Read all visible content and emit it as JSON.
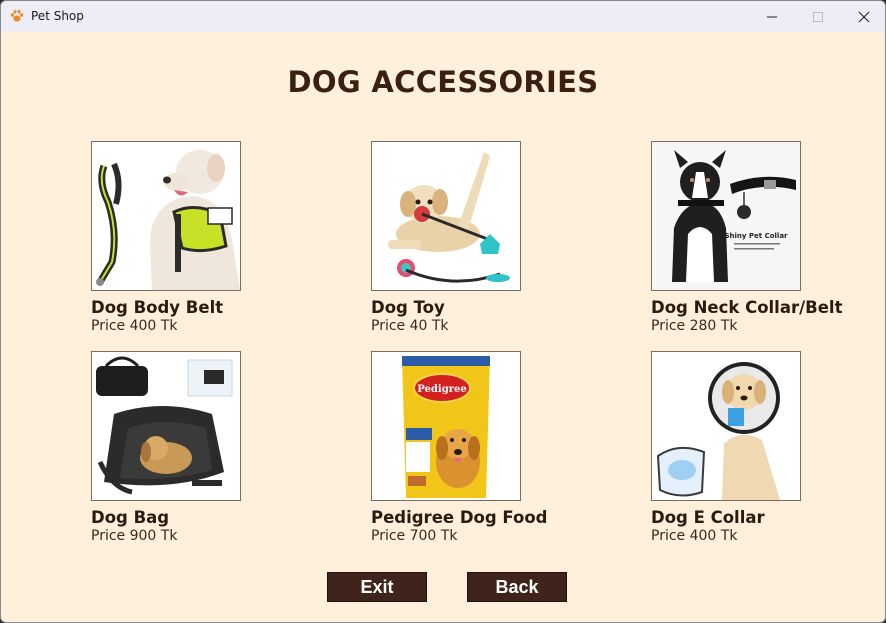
{
  "window": {
    "title": "Pet Shop",
    "icon": "paw-icon"
  },
  "page": {
    "heading": "DOG ACCESSORIES"
  },
  "products": [
    {
      "name": "Dog Body Belt",
      "price": "Price 400 Tk",
      "image": "dog-harness-image"
    },
    {
      "name": "Dog Toy",
      "price": "Price 40 Tk",
      "image": "dog-toy-image"
    },
    {
      "name": "Dog Neck Collar/Belt",
      "price": "Price 280 Tk",
      "image": "dog-collar-image",
      "image_caption": "Shiny Pet Collar"
    },
    {
      "name": "Dog Bag",
      "price": "Price 900 Tk",
      "image": "dog-bag-image"
    },
    {
      "name": "Pedigree Dog Food",
      "price": "Price 700 Tk",
      "image": "pedigree-bag-image",
      "image_caption": "Pedigree"
    },
    {
      "name": "Dog E Collar",
      "price": "Price 400 Tk",
      "image": "dog-e-collar-image"
    }
  ],
  "buttons": {
    "exit": "Exit",
    "back": "Back"
  },
  "colors": {
    "background": "#fff0dc",
    "heading": "#3b1f12",
    "button": "#40231a"
  }
}
